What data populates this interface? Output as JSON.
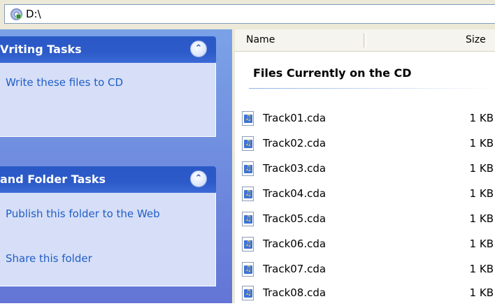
{
  "address": {
    "path": "D:\\"
  },
  "tasks": {
    "writing": {
      "title": "Vriting Tasks",
      "links": [
        "Write these files to CD"
      ]
    },
    "file_folder": {
      "title": "and Folder Tasks",
      "links": [
        "Publish this folder to the Web",
        "Share this folder"
      ]
    }
  },
  "columns": {
    "name": "Name",
    "size": "Size"
  },
  "group_header": "Files Currently on the CD",
  "files": [
    {
      "name": "Track01.cda",
      "size": "1 KB"
    },
    {
      "name": "Track02.cda",
      "size": "1 KB"
    },
    {
      "name": "Track03.cda",
      "size": "1 KB"
    },
    {
      "name": "Track04.cda",
      "size": "1 KB"
    },
    {
      "name": "Track05.cda",
      "size": "1 KB"
    },
    {
      "name": "Track06.cda",
      "size": "1 KB"
    },
    {
      "name": "Track07.cda",
      "size": "1 KB"
    },
    {
      "name": "Track08.cda",
      "size": "1 KB"
    }
  ],
  "icons": {
    "address": "cd-drive-icon",
    "file": "audio-track-icon",
    "collapse": "chevron-up-double-icon"
  },
  "colors": {
    "taskpane_bg": "#6f8fe0",
    "header_blue": "#2c5ac8",
    "panel_body": "#d6dff7",
    "link": "#215dc6"
  }
}
